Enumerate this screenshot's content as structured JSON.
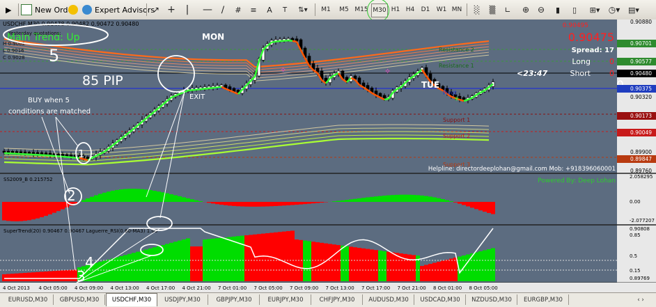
{
  "toolbar": {
    "new_order": "New Order",
    "expert_advisors": "Expert Advisors",
    "timeframes": [
      "M1",
      "M5",
      "M15",
      "M30",
      "H1",
      "H4",
      "D1",
      "W1",
      "MN"
    ],
    "active_timeframe": "M30"
  },
  "chart": {
    "header": "USDCHF,M30  0.90478 0.90482 0.90472 0.90480",
    "main_trend": "Main Trend: Up",
    "yesterday": "Yesterday quotations:",
    "yq_h": "H 0.9062",
    "yq_l": "L 0.9016",
    "yq_c": "C 0.9028",
    "bid_small": "0.90495",
    "bid_big": "0.90475",
    "spread": "Spread: 17",
    "long_label": "Long",
    "long_val": "0",
    "short_label": "Short",
    "short_val": "0",
    "zero_big": "0",
    "countdown": "<23:47",
    "pip": "85 PIP",
    "buy_note_1": "BUY when 5",
    "buy_note_2": "conditions are matched",
    "exit": "EXIT",
    "mon": "MON",
    "tue": "TUE",
    "resistance_2": "Resistance 2",
    "resistance_1": "Resistance 1",
    "pivot": "Pivot",
    "support_1": "Support 1",
    "support_2": "Support 2",
    "support_3": "Support 3",
    "helpline": "Helpline: directordeeplohan@gmail.com  Mob: +918396060001",
    "powered_by": "Powered By: Deep Lohan",
    "annot_1": "1",
    "annot_2": "2",
    "annot_3": "3",
    "annot_4": "4",
    "annot_5": "5",
    "prices": [
      {
        "v": "0.90880",
        "c": ""
      },
      {
        "v": "0.90701",
        "c": "#2e8b2e"
      },
      {
        "v": "0.90577",
        "c": "#2e8b2e"
      },
      {
        "v": "0.90480",
        "c": "#000"
      },
      {
        "v": "0.90375",
        "c": "#1f3dbf"
      },
      {
        "v": "0.90320",
        "c": ""
      },
      {
        "v": "0.90173",
        "c": "#9a1010"
      },
      {
        "v": "0.90049",
        "c": "#c81a1a"
      },
      {
        "v": "0.89900",
        "c": ""
      },
      {
        "v": "0.89847",
        "c": "#b83a10"
      },
      {
        "v": "0.89760",
        "c": ""
      }
    ],
    "ind1_label": "SS2009_B 0.215752",
    "ind1_ticks": [
      "2.058295",
      "0.00",
      "-2.077207"
    ],
    "ind2_label": "SuperTrend(20) 0.90467 0.90467  Laguerre_RSI(0.60-MA3) 1.00",
    "ind2_ticks": [
      "0.90808",
      "0.85",
      "0.5",
      "0.15",
      "0.89769"
    ],
    "time_labels": [
      "4 Oct 2013",
      "4 Oct 05:00",
      "4 Oct 09:00",
      "4 Oct 13:00",
      "4 Oct 17:00",
      "4 Oct 21:00",
      "7 Oct 01:00",
      "7 Oct 05:00",
      "7 Oct 09:00",
      "7 Oct 13:00",
      "7 Oct 17:00",
      "7 Oct 21:00",
      "8 Oct 01:00",
      "8 Oct 05:00"
    ]
  },
  "tabs": [
    "EURUSD,M30",
    "GBPUSD,M30",
    "USDCHF,M30",
    "USDJPY,M30",
    "GBPJPY,M30",
    "EURJPY,M30",
    "CHFJPY,M30",
    "AUDUSD,M30",
    "USDCAD,M30",
    "NZDUSD,M30",
    "EURGBP,M30"
  ],
  "active_tab": "USDCHF,M30",
  "colors": {
    "bull": "#00cc00",
    "bear": "#dd0000",
    "trend_up": "#33ff33",
    "trend_down": "#ff5500",
    "bg": "#5b6b7f"
  }
}
